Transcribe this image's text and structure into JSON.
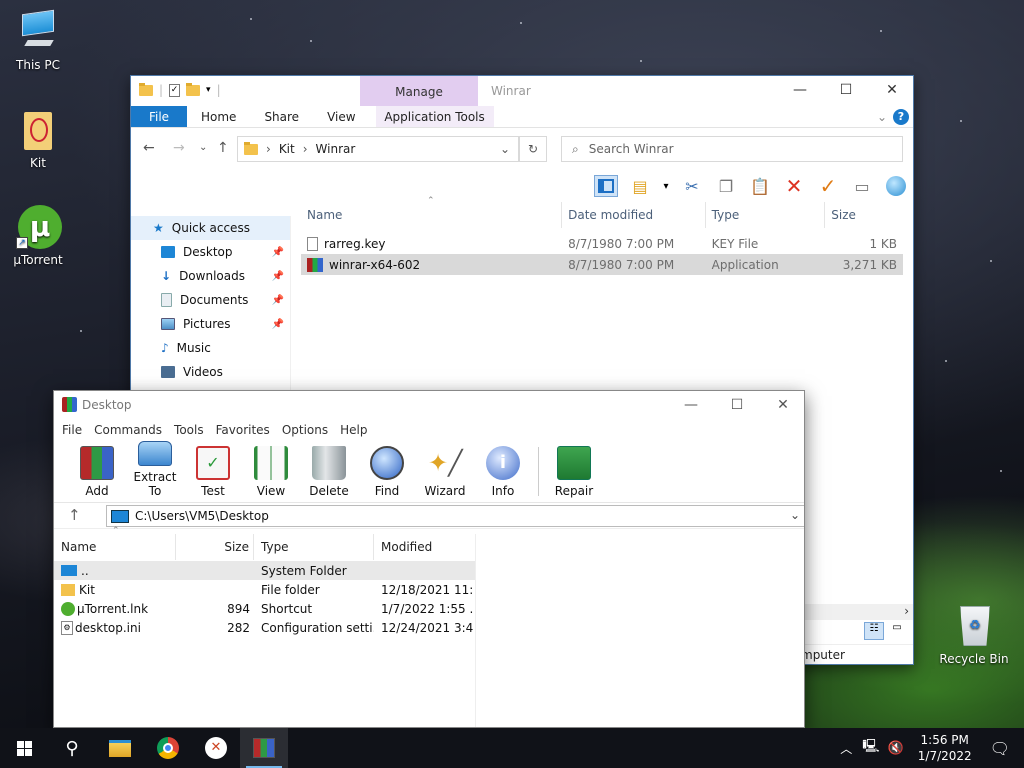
{
  "desktop": {
    "icons": [
      {
        "label": "This PC"
      },
      {
        "label": "Kit"
      },
      {
        "label": "µTorrent"
      },
      {
        "label": "Recycle Bin"
      }
    ]
  },
  "explorer": {
    "ribbon_context": "Manage",
    "window_title": "Winrar",
    "tabs": {
      "file": "File",
      "home": "Home",
      "share": "Share",
      "view": "View",
      "app_tools": "Application Tools"
    },
    "help": "?",
    "breadcrumb": [
      "Kit",
      "Winrar"
    ],
    "search_placeholder": "Search Winrar",
    "nav_pane": [
      {
        "label": "Quick access"
      },
      {
        "label": "Desktop"
      },
      {
        "label": "Downloads"
      },
      {
        "label": "Documents"
      },
      {
        "label": "Pictures"
      },
      {
        "label": "Music"
      },
      {
        "label": "Videos"
      }
    ],
    "columns": [
      "Name",
      "Date modified",
      "Type",
      "Size"
    ],
    "files": [
      {
        "name": "rarreg.key",
        "date": "8/7/1980 7:00 PM",
        "type": "KEY File",
        "size": "1 KB"
      },
      {
        "name": "winrar-x64-602",
        "date": "8/7/1980 7:00 PM",
        "type": "Application",
        "size": "3,271 KB"
      }
    ],
    "status_partial": "mputer"
  },
  "winrar": {
    "title": "Desktop",
    "menu": [
      "File",
      "Commands",
      "Tools",
      "Favorites",
      "Options",
      "Help"
    ],
    "tools": [
      {
        "label": "Add"
      },
      {
        "label": "Extract To"
      },
      {
        "label": "Test"
      },
      {
        "label": "View"
      },
      {
        "label": "Delete"
      },
      {
        "label": "Find"
      },
      {
        "label": "Wizard"
      },
      {
        "label": "Info"
      },
      {
        "label": "Repair"
      }
    ],
    "path": "C:\\Users\\VM5\\Desktop",
    "columns": [
      "Name",
      "Size",
      "Type",
      "Modified"
    ],
    "rows": [
      {
        "name": "..",
        "size": "",
        "type": "System Folder",
        "modified": ""
      },
      {
        "name": "Kit",
        "size": "",
        "type": "File folder",
        "modified": "12/18/2021 11:..."
      },
      {
        "name": "µTorrent.lnk",
        "size": "894",
        "type": "Shortcut",
        "modified": "1/7/2022 1:55 ..."
      },
      {
        "name": "desktop.ini",
        "size": "282",
        "type": "Configuration setti...",
        "modified": "12/24/2021 3:4..."
      }
    ]
  },
  "taskbar": {
    "time": "1:56 PM",
    "date": "1/7/2022"
  },
  "colors": {
    "accent": "#1979ca",
    "manage_tab": "#e2cdf0",
    "selection": "#d9d9d9"
  }
}
